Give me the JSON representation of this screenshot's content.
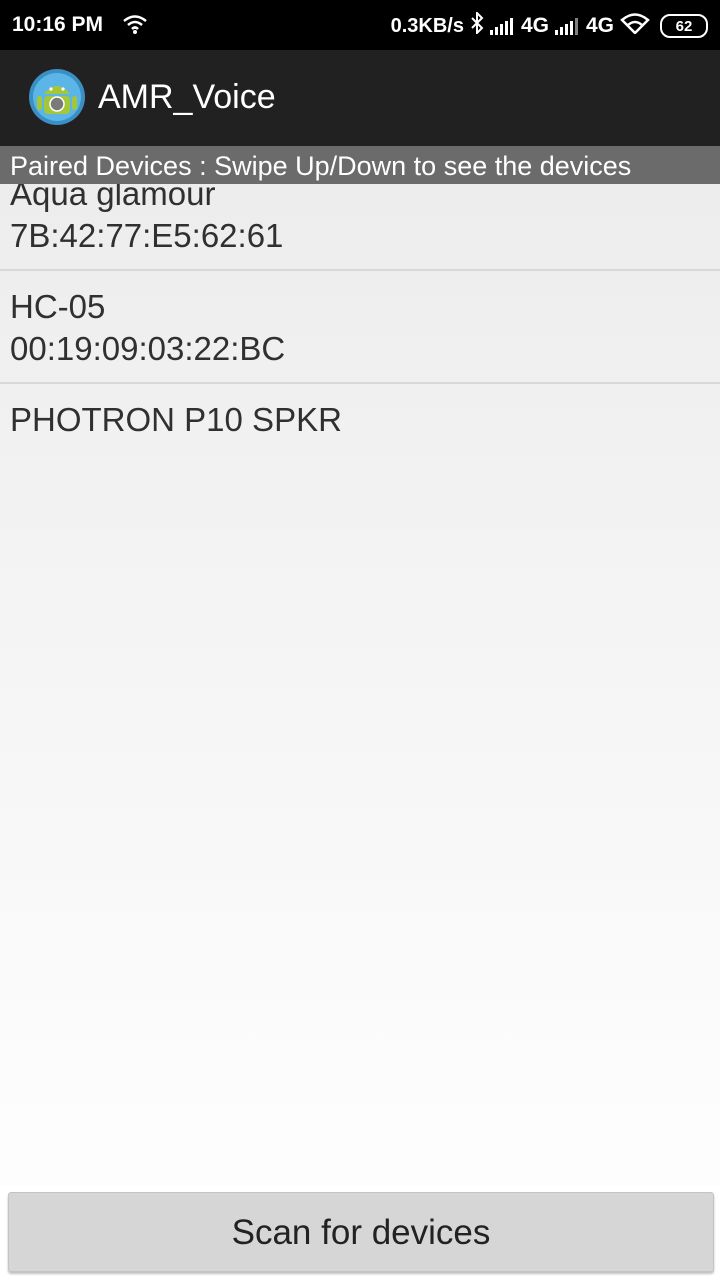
{
  "status_bar": {
    "time": "10:16 PM",
    "speed": "0.3KB/s",
    "net1": "4G",
    "net2": "4G",
    "battery": "62",
    "icons": [
      "wifi-icon",
      "bluetooth-icon",
      "signal-icon",
      "battery-icon"
    ]
  },
  "app": {
    "title": "AMR_Voice",
    "icon": "android-app-icon",
    "bar_color": "#212121"
  },
  "header": {
    "text": "Paired Devices : Swipe Up/Down to see the devices"
  },
  "devices": [
    {
      "name": "Aqua glamour",
      "address": "7B:42:77:E5:62:61"
    },
    {
      "name": "HC-05",
      "address": "00:19:09:03:22:BC"
    },
    {
      "name": "PHOTRON P10 SPKR",
      "address": ""
    }
  ],
  "scan_button": {
    "label": "Scan for devices"
  }
}
